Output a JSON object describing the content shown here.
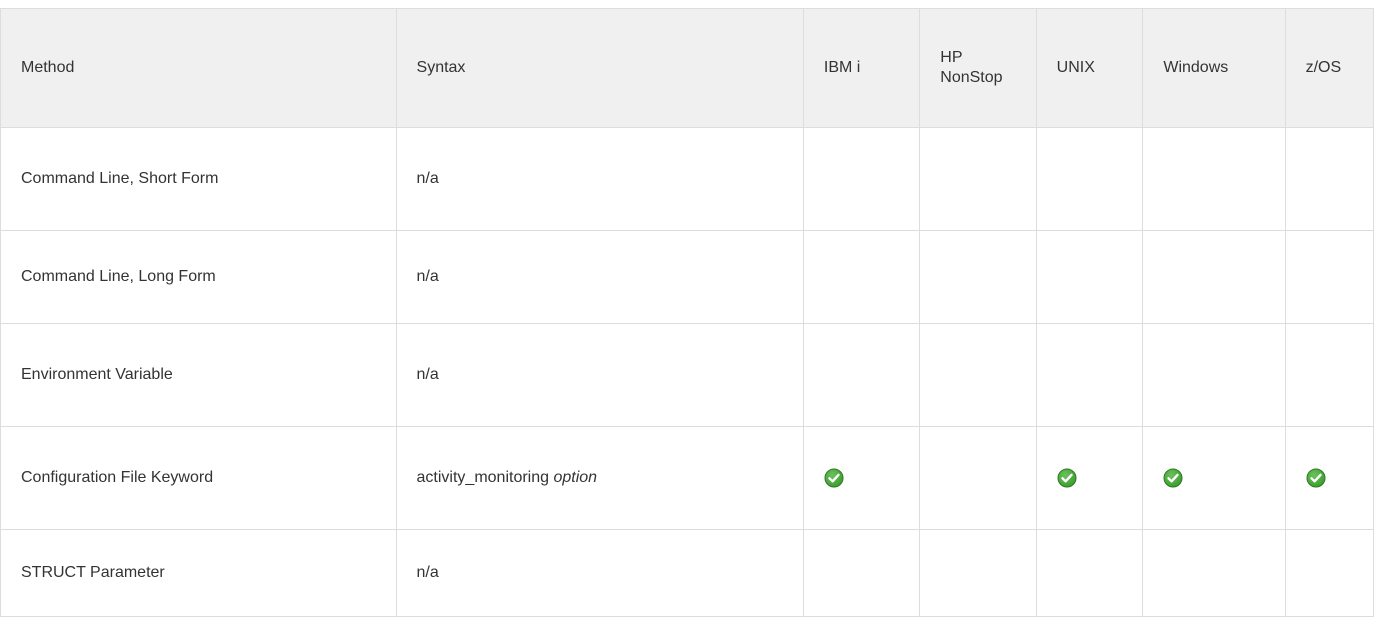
{
  "table": {
    "headers": {
      "method": "Method",
      "syntax": "Syntax",
      "ibm_i": "IBM i",
      "hp_nonstop_line1": "HP",
      "hp_nonstop_line2": "NonStop",
      "unix": "UNIX",
      "windows": "Windows",
      "zos": "z/OS"
    },
    "rows": [
      {
        "method": "Command Line, Short Form",
        "syntax": "n/a",
        "supported": {
          "ibm_i": false,
          "hp_nonstop": false,
          "unix": false,
          "windows": false,
          "zos": false
        }
      },
      {
        "method": "Command Line, Long Form",
        "syntax": "n/a",
        "supported": {
          "ibm_i": false,
          "hp_nonstop": false,
          "unix": false,
          "windows": false,
          "zos": false
        }
      },
      {
        "method": "Environment Variable",
        "syntax": "n/a",
        "supported": {
          "ibm_i": false,
          "hp_nonstop": false,
          "unix": false,
          "windows": false,
          "zos": false
        }
      },
      {
        "method": "Configuration File Keyword",
        "syntax": "activity_monitoring",
        "syntax_option": "option",
        "supported": {
          "ibm_i": true,
          "hp_nonstop": false,
          "unix": true,
          "windows": true,
          "zos": true
        }
      },
      {
        "method": "STRUCT Parameter",
        "syntax": "n/a",
        "supported": {
          "ibm_i": false,
          "hp_nonstop": false,
          "unix": false,
          "windows": false,
          "zos": false
        }
      }
    ]
  },
  "icons": {
    "supported": "check-circle-icon"
  },
  "colors": {
    "check_fill": "#3a9b2e",
    "header_bg": "#f0f0f0",
    "border": "#dddddd"
  }
}
